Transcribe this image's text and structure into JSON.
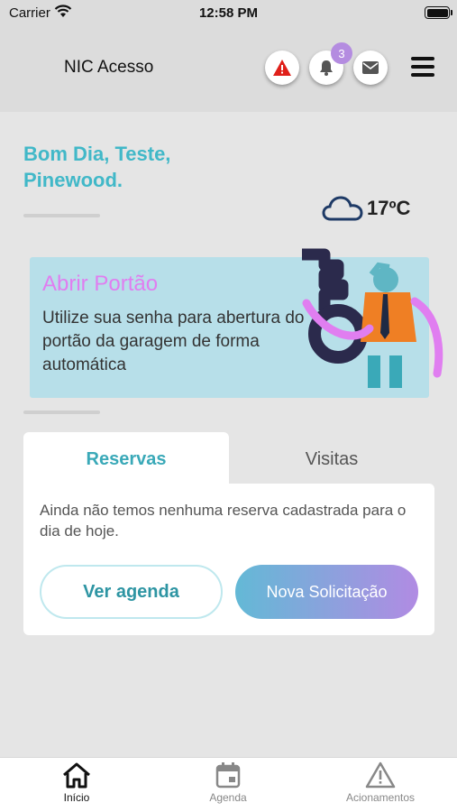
{
  "status": {
    "carrier": "Carrier",
    "time": "12:58 PM"
  },
  "header": {
    "title": "NIC Acesso",
    "notification_count": "3"
  },
  "greeting": {
    "line1": "Bom Dia, Teste,",
    "line2": "Pinewood."
  },
  "weather": {
    "temperature": "17ºC",
    "icon": "cloud-icon"
  },
  "gate_card": {
    "title": "Abrir Portão",
    "description": "Utilize sua senha para abertura do portão da garagem de forma automática"
  },
  "tabs": {
    "reservas": "Reservas",
    "visitas": "Visitas"
  },
  "reservas_panel": {
    "empty_message": "Ainda não temos nenhuma reserva cadastrada para o dia de hoje.",
    "agenda_button": "Ver agenda",
    "new_request_button": "Nova Solicitação"
  },
  "tabbar": {
    "home": "Início",
    "agenda": "Agenda",
    "actions": "Acionamentos"
  },
  "colors": {
    "accent": "#41b8c8",
    "gate_title": "#e07ef0",
    "badge": "#b48ce0",
    "alert": "#e0201a"
  }
}
